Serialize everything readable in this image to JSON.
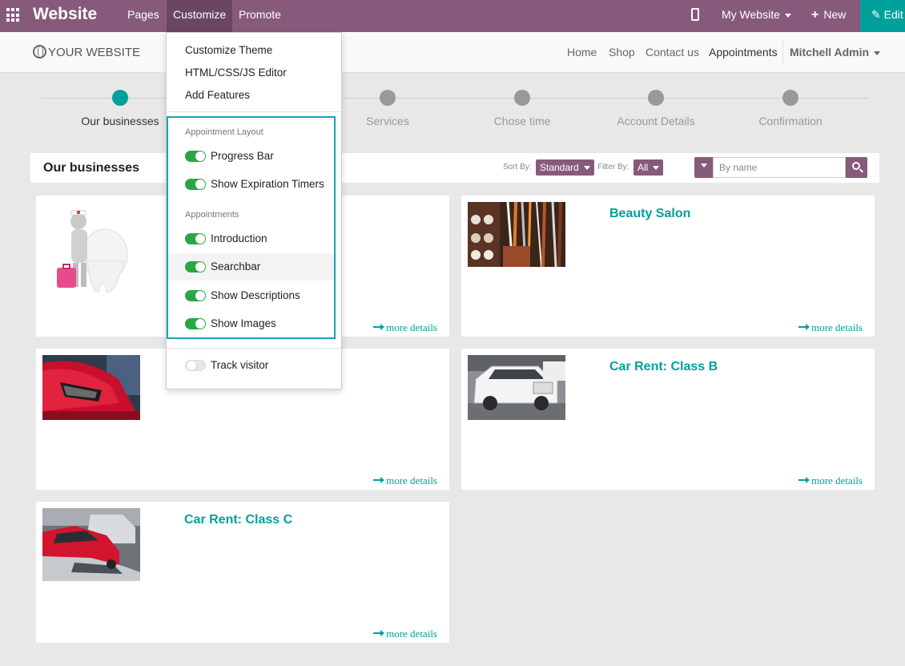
{
  "topbar": {
    "brand": "Website",
    "menus": [
      "Pages",
      "Customize",
      "Promote"
    ],
    "my_website": "My Website",
    "new_label": "New",
    "edit_label": "Edit"
  },
  "site": {
    "logo": "YOUR WEBSITE",
    "nav": [
      "Home",
      "Shop",
      "Contact us",
      "Appointments"
    ],
    "user": "Mitchell Admin"
  },
  "steps": [
    "Our businesses",
    "Services",
    "Chose time",
    "Account Details",
    "Confirmation"
  ],
  "filterbar": {
    "title": "Our businesses",
    "sort_label": "Sort By:",
    "sort_value": "Standard",
    "filter_label": "Filter By:",
    "filter_value": "All",
    "search_placeholder": "By name"
  },
  "cards": [
    {
      "title": "",
      "more": "more details"
    },
    {
      "title": "Beauty Salon",
      "more": "more details"
    },
    {
      "title": "",
      "more": "more details"
    },
    {
      "title": "Car Rent: Class B",
      "more": "more details"
    },
    {
      "title": "Car Rent: Class C",
      "more": "more details"
    }
  ],
  "customize_menu": {
    "top_items": [
      "Customize Theme",
      "HTML/CSS/JS Editor",
      "Add Features"
    ],
    "layout_header": "Appointment Layout",
    "layout_items": [
      "Progress Bar",
      "Show Expiration Timers"
    ],
    "appointments_header": "Appointments",
    "appointment_items": [
      "Introduction",
      "Searchbar",
      "Show Descriptions",
      "Show Images"
    ],
    "track_visitor": "Track visitor"
  },
  "colors": {
    "brand": "#875a7b",
    "accent": "#00a09d",
    "toggle_on": "#28a745",
    "highlight": "#17a2b8"
  },
  "icons": [
    "apps-grid-icon",
    "mobile-preview-icon",
    "plus-icon",
    "pencil-icon",
    "globe-icon",
    "search-icon"
  ]
}
